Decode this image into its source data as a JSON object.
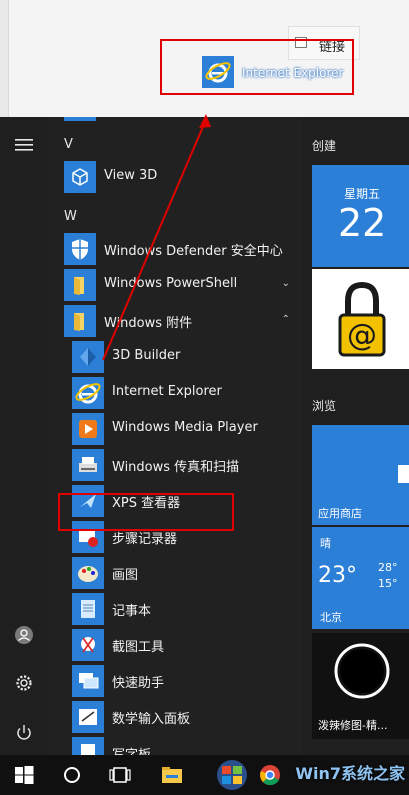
{
  "explorer": {
    "link_label": "链接",
    "drag_label": "Internet Explorer"
  },
  "applist": {
    "letter_v": "V",
    "letter_w": "W",
    "items": [
      {
        "label": "View 3D"
      },
      {
        "label": "Windows Defender 安全中心"
      },
      {
        "label": "Windows PowerShell"
      },
      {
        "label": "Windows 附件"
      },
      {
        "label": "3D Builder"
      },
      {
        "label": "Internet Explorer"
      },
      {
        "label": "Windows Media Player"
      },
      {
        "label": "Windows 传真和扫描"
      },
      {
        "label": "XPS 查看器"
      },
      {
        "label": "步骤记录器"
      },
      {
        "label": "画图"
      },
      {
        "label": "记事本"
      },
      {
        "label": "截图工具"
      },
      {
        "label": "快速助手"
      },
      {
        "label": "数学输入面板"
      },
      {
        "label": "写字板"
      }
    ],
    "chevron_down": "⌄",
    "chevron_up": "⌃"
  },
  "tiles": {
    "group1_title": "创建",
    "calendar_day_name": "星期五",
    "calendar_day_num": "22",
    "group2_title": "浏览",
    "store_label": "应用商店",
    "weather_cond": "晴",
    "weather_temp": "23°",
    "weather_high": "28°",
    "weather_low": "15°",
    "weather_city": "北京",
    "bottom_tile_label": "泼辣修图-精..."
  },
  "watermark": "Win7系统之家",
  "colors": {
    "accent": "#2b7fd6",
    "highlight": "#e00000"
  }
}
